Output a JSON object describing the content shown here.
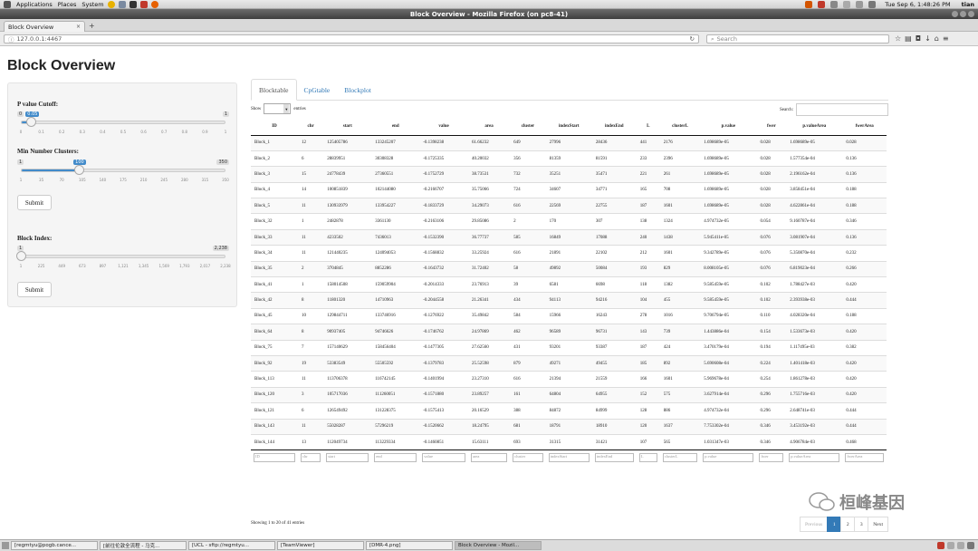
{
  "topbar": {
    "menus": [
      "Applications",
      "Places",
      "System"
    ],
    "clock": "Tue Sep  6,  1:48:26 PM",
    "user": "tian"
  },
  "window": {
    "title": "Block Overview - Mozilla Firefox (on pc8-41)"
  },
  "browser": {
    "tab_title": "Block Overview",
    "tab_close": "×",
    "new_tab": "+",
    "url_host": "127.0.0.1",
    "url_port": ":4467",
    "search_placeholder": "Search"
  },
  "page": {
    "title": "Block Overview"
  },
  "sidebar": {
    "pvalue": {
      "label": "P value Cutoff:",
      "min": "0",
      "max": "1",
      "value": "0.05",
      "value_fraction": 0.05,
      "ticks": [
        "0",
        "0.1",
        "0.2",
        "0.3",
        "0.4",
        "0.5",
        "0.6",
        "0.7",
        "0.8",
        "0.9",
        "1"
      ]
    },
    "mincluster": {
      "label": "Min Number Clusters:",
      "min": "1",
      "max": "350",
      "value": "100",
      "value_fraction": 0.284,
      "ticks": [
        "1",
        "35",
        "70",
        "105",
        "140",
        "175",
        "210",
        "245",
        "280",
        "315",
        "350"
      ]
    },
    "submit1": "Submit",
    "blockindex": {
      "label": "Block Index:",
      "min": "1",
      "max": "2,238",
      "value_fraction": 0,
      "ticks": [
        "1",
        "225",
        "449",
        "673",
        "897",
        "1,121",
        "1,345",
        "1,569",
        "1,793",
        "2,017",
        "2,238"
      ]
    },
    "submit2": "Submit"
  },
  "tabs": [
    "Blocktable",
    "CpGtable",
    "Blockplot"
  ],
  "table_controls": {
    "show": "Show",
    "entries": "entries",
    "search_label": "Search:"
  },
  "table": {
    "columns": [
      "ID",
      "chr",
      "start",
      "end",
      "value",
      "area",
      "cluster",
      "indexStart",
      "indexEnd",
      "L",
      "clusterL",
      "p.value",
      "fwer",
      "p.valueArea",
      "fwerArea"
    ],
    "rows": [
      [
        "Block_1",
        "12",
        "125405786",
        "133245207",
        "-0.1398238",
        "61.66232",
        "649",
        "27996",
        "28436",
        "441",
        "2176",
        "1.698689e-05",
        "0.028",
        "1.698689e-05",
        "0.028"
      ],
      [
        "Block_2",
        "6",
        "28839951",
        "30308328",
        "-0.1725335",
        "40.20032",
        "356",
        "81359",
        "81591",
        "233",
        "2396",
        "1.698689e-05",
        "0.028",
        "1.577354e-04",
        "0.136"
      ],
      [
        "Block_3",
        "15",
        "24778439",
        "27360551",
        "-0.1752729",
        "38.73531",
        "732",
        "35251",
        "35471",
        "221",
        "261",
        "1.698689e-05",
        "0.028",
        "2.196162e-04",
        "0.136"
      ],
      [
        "Block_4",
        "14",
        "100851839",
        "102144080",
        "-0.2166707",
        "35.75066",
        "724",
        "34607",
        "34771",
        "165",
        "708",
        "1.698689e-05",
        "0.028",
        "3.858451e-04",
        "0.188"
      ],
      [
        "Block_5",
        "11",
        "130933979",
        "133954227",
        "-0.1833729",
        "34.29073",
        "616",
        "22569",
        "22755",
        "187",
        "1601",
        "1.698689e-05",
        "0.028",
        "4.622861e-04",
        "0.188"
      ],
      [
        "Block_32",
        "1",
        "2482878",
        "3361130",
        "-0.2163106",
        "29.85086",
        "2",
        "170",
        "307",
        "138",
        "1324",
        "4.974732e-05",
        "0.054",
        "9.160787e-04",
        "0.346"
      ],
      [
        "Block_33",
        "11",
        "4233502",
        "7436013",
        "-0.1532390",
        "36.77737",
        "585",
        "16849",
        "17088",
        "240",
        "1438",
        "5.945411e-05",
        "0.076",
        "3.081907e-04",
        "0.136"
      ],
      [
        "Block_34",
        "11",
        "121440235",
        "124094053",
        "-0.1568832",
        "33.25924",
        "616",
        "21891",
        "22102",
        "212",
        "1601",
        "9.342789e-05",
        "0.076",
        "5.350870e-04",
        "0.232"
      ],
      [
        "Block_35",
        "2",
        "3704845",
        "8852286",
        "-0.1643732",
        "31.72402",
        "58",
        "49892",
        "50084",
        "193",
        "829",
        "8.008105e-05",
        "0.076",
        "6.819023e-04",
        "0.266"
      ],
      [
        "Block_41",
        "1",
        "158014508",
        "159059904",
        "-0.2014333",
        "23.76913",
        "39",
        "6581",
        "6698",
        "118",
        "1382",
        "9.585459e-05",
        "0.102",
        "1.788427e-03",
        "0.420"
      ],
      [
        "Block_42",
        "8",
        "11801320",
        "14710963",
        "-0.2044558",
        "21.26341",
        "434",
        "94113",
        "94216",
        "104",
        "455",
        "9.585459e-05",
        "0.102",
        "2.393938e-03",
        "0.444"
      ],
      [
        "Block_45",
        "10",
        "129844711",
        "133746916",
        "-0.1276922",
        "35.49842",
        "584",
        "15966",
        "16243",
        "278",
        "1016",
        "9.706794e-05",
        "0.110",
        "4.028320e-04",
        "0.188"
      ],
      [
        "Block_64",
        "8",
        "90937405",
        "94746626",
        "-0.1746762",
        "24.97869",
        "462",
        "96589",
        "96731",
        "143",
        "739",
        "1.443886e-04",
        "0.154",
        "1.533673e-03",
        "0.420"
      ],
      [
        "Block_75",
        "7",
        "157140629",
        "158456404",
        "-0.1477305",
        "27.62560",
        "431",
        "93201",
        "93387",
        "187",
        "424",
        "3.470179e-04",
        "0.194",
        "1.117495e-03",
        "0.382"
      ],
      [
        "Block_92",
        "19",
        "53383549",
        "55505592",
        "-0.1379783",
        "25.52598",
        "879",
        "49271",
        "49455",
        "185",
        "892",
        "5.690608e-04",
        "0.224",
        "1.401418e-03",
        "0.420"
      ],
      [
        "Block_113",
        "11",
        "113706378",
        "116742145",
        "-0.1401994",
        "23.27310",
        "616",
        "21394",
        "21559",
        "166",
        "1601",
        "5.969678e-04",
        "0.254",
        "1.861278e-03",
        "0.420"
      ],
      [
        "Block_120",
        "3",
        "105717036",
        "111260051",
        "-0.1571880",
        "23.89257",
        "161",
        "64804",
        "64955",
        "152",
        "575",
        "3.627914e-04",
        "0.296",
        "1.755716e-03",
        "0.420"
      ],
      [
        "Block_121",
        "6",
        "126549492",
        "131228375",
        "-0.1575413",
        "20.16529",
        "388",
        "84872",
        "84999",
        "128",
        "886",
        "4.974732e-04",
        "0.296",
        "2.648741e-03",
        "0.444"
      ],
      [
        "Block_143",
        "11",
        "55028287",
        "57296219",
        "-0.1520662",
        "18.24795",
        "681",
        "18791",
        "18910",
        "120",
        "1637",
        "7.753302e-04",
        "0.346",
        "3.453192e-03",
        "0.444"
      ],
      [
        "Block_144",
        "13",
        "112049734",
        "113229334",
        "-0.1460851",
        "15.63111",
        "693",
        "31315",
        "31421",
        "107",
        "565",
        "1.031347e-03",
        "0.346",
        "4.906784e-03",
        "0.468"
      ]
    ]
  },
  "info": "Showing 1 to 20 of 41 entries",
  "pager": [
    "Previous",
    "1",
    "2",
    "3",
    "Next"
  ],
  "watermark": "桓峰基因",
  "taskbar": [
    "[regmtyu@pogb.cance...",
    "[前往伦敦全流程 - 马克...",
    "[UCL - sftp://regmtyu...",
    "[TeamViewer]",
    "[DMR-4.png]",
    "Block Overview - Mozil..."
  ],
  "colors": {
    "accent": "#428bca",
    "link": "#337ab7",
    "pager_active": "#337ab7"
  }
}
